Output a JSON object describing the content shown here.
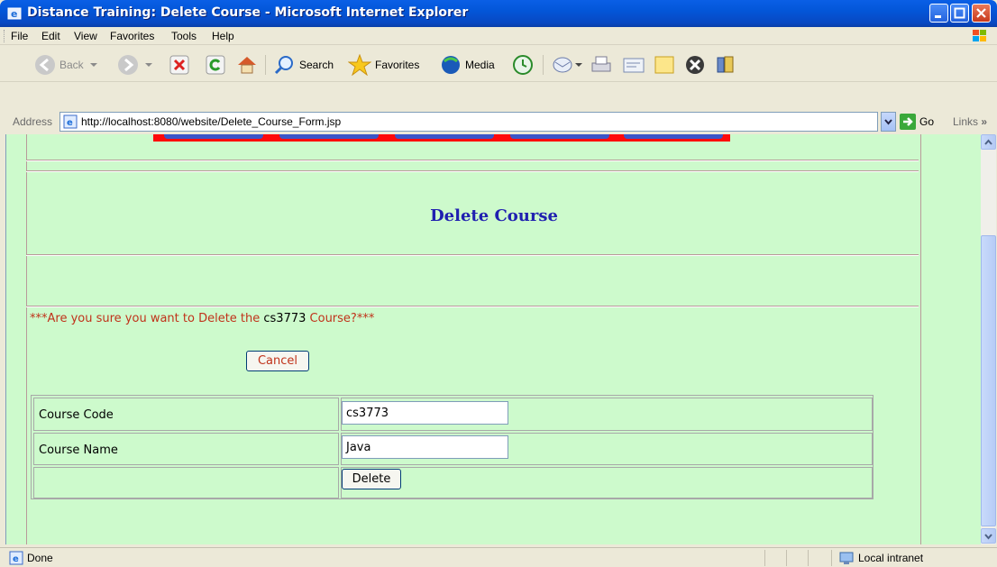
{
  "window": {
    "title": "Distance Training: Delete Course - Microsoft Internet Explorer"
  },
  "menu": {
    "items": [
      "File",
      "Edit",
      "View",
      "Favorites",
      "Tools",
      "Help"
    ]
  },
  "toolbar": {
    "back_label": "Back",
    "search_label": "Search",
    "favorites_label": "Favorites",
    "media_label": "Media"
  },
  "address": {
    "label": "Address",
    "url": "http://localhost:8080/website/Delete_Course_Form.jsp",
    "go_label": "Go",
    "links_label": "Links"
  },
  "page": {
    "heading": "Delete Course",
    "confirm_prefix": "***Are you sure you want to Delete the ",
    "confirm_code": "cs3773",
    "confirm_suffix": " Course?***",
    "cancel_label": "Cancel",
    "form": {
      "course_code_label": "Course Code",
      "course_code_value": "cs3773",
      "course_name_label": "Course Name",
      "course_name_value": "Java",
      "delete_label": "Delete"
    }
  },
  "status": {
    "text": "Done",
    "zone": "Local intranet"
  },
  "colors": {
    "page_bg": "#CDFACC",
    "heading": "#2020B0",
    "warning_text": "#C0321A",
    "nav_strip": "#FF0A0A"
  }
}
